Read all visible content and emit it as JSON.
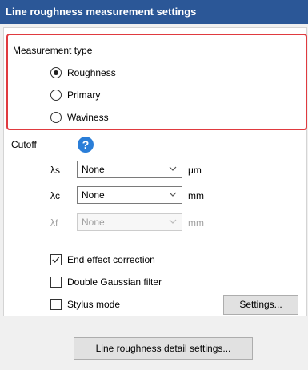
{
  "window": {
    "title": "Line roughness measurement settings"
  },
  "measurement_type": {
    "heading": "Measurement type",
    "options": [
      {
        "label": "Roughness",
        "selected": true
      },
      {
        "label": "Primary",
        "selected": false
      },
      {
        "label": "Waviness",
        "selected": false
      }
    ]
  },
  "cutoff": {
    "label": "Cutoff",
    "help_icon": "question-circle-icon",
    "rows": [
      {
        "symbol": "λs",
        "value": "None",
        "unit": "μm",
        "enabled": true
      },
      {
        "symbol": "λc",
        "value": "None",
        "unit": "mm",
        "enabled": true
      },
      {
        "symbol": "λf",
        "value": "None",
        "unit": "mm",
        "enabled": false
      }
    ]
  },
  "options": {
    "end_effect": {
      "label": "End effect correction",
      "checked": true
    },
    "double_gaussian": {
      "label": "Double Gaussian filter",
      "checked": false
    },
    "stylus_mode": {
      "label": "Stylus mode",
      "checked": false
    }
  },
  "buttons": {
    "settings": "Settings...",
    "detail_settings": "Line roughness detail settings..."
  },
  "colors": {
    "title_bar": "#2b5797",
    "highlight_border": "#e03a3f",
    "help_icon": "#2a7ed8"
  }
}
